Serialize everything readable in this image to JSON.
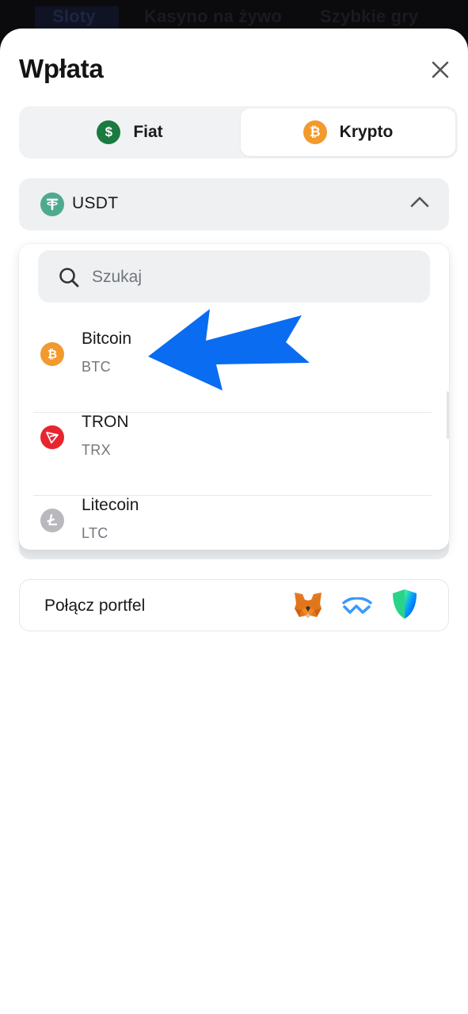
{
  "background_nav": {
    "tabs": [
      "Sloty",
      "Kasyno na żywo",
      "Szybkie gry"
    ]
  },
  "modal": {
    "title": "Wpłata",
    "close_icon": "close-icon"
  },
  "tabs": [
    {
      "label": "Fiat",
      "icon": "dollar-coin-icon",
      "icon_glyph": "$",
      "selected": false
    },
    {
      "label": "Krypto",
      "icon": "bitcoin-icon",
      "icon_glyph": "₿",
      "selected": true
    }
  ],
  "currency_select": {
    "value": "USDT",
    "icon": "tether-icon",
    "expanded": true
  },
  "search": {
    "placeholder": "Szukaj",
    "value": ""
  },
  "options": [
    {
      "name": "Bitcoin",
      "symbol": "BTC",
      "icon": "bitcoin-icon",
      "color": "#f29a2e"
    },
    {
      "name": "TRON",
      "symbol": "TRX",
      "icon": "tron-icon",
      "color": "#e8252f"
    },
    {
      "name": "Litecoin",
      "symbol": "LTC",
      "icon": "litecoin-icon",
      "color": "#b9b9bd"
    }
  ],
  "wallet": {
    "label": "Połącz portfel",
    "icons": [
      "metamask-icon",
      "walletconnect-icon",
      "trust-wallet-icon"
    ]
  },
  "annotation": {
    "arrow_color": "#0a6cf0",
    "points_to": "Bitcoin"
  }
}
